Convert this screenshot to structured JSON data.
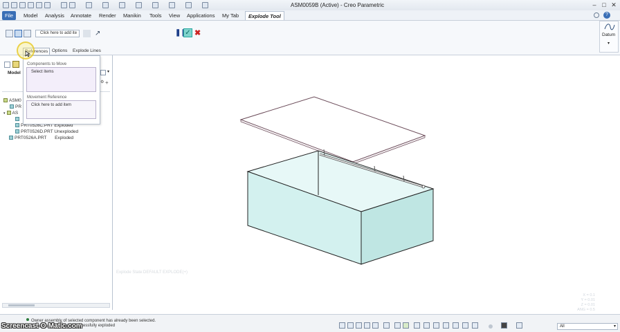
{
  "window": {
    "title": "ASM0059B (Active) - Creo Parametric"
  },
  "menu": {
    "tabs": [
      "File",
      "Model",
      "Analysis",
      "Annotate",
      "Render",
      "Manikin",
      "Tools",
      "View",
      "Applications",
      "My Tab",
      "Explode Tool"
    ]
  },
  "ribbon": {
    "reference_field": "Click here to add ite",
    "subtabs": [
      "References",
      "Options",
      "Explode Lines"
    ],
    "datum_label": "Datum"
  },
  "references_panel": {
    "components_label": "Components to Move",
    "components_value": "Select items",
    "movement_label": "Movement Reference",
    "movement_value": "Click here to add item"
  },
  "model_tree": {
    "tab_label": "Model",
    "rows": [
      {
        "name": "ASM0",
        "status": ""
      },
      {
        "name": "PR",
        "status": ""
      },
      {
        "name": "AS",
        "status": ""
      },
      {
        "name": "",
        "status": ""
      },
      {
        "name": "PRT0526C.PRT",
        "status": "Exploded"
      },
      {
        "name": "PRT0526D.PRT",
        "status": "Unexploded"
      },
      {
        "name": "PRT0526A.PRT",
        "status": "Exploded"
      }
    ]
  },
  "graphics": {
    "state_text": "Explode State:DEFAULT EXPLODE(+)",
    "coords": [
      "X = 0.1",
      "Y = 0.01",
      "Z = 0.01",
      "ANG = 0.5"
    ]
  },
  "status": {
    "messages": [
      "Owner assembly of selected component has already been selected.",
      "have been successfully exploded"
    ],
    "filter_value": "All",
    "watermark": "Screencast-O-Matic.com"
  },
  "colors": {
    "accent": "#3a6fb6",
    "box_face": "#d6f2f1",
    "check": "#2aa8a0",
    "cancel": "#cc2222"
  }
}
